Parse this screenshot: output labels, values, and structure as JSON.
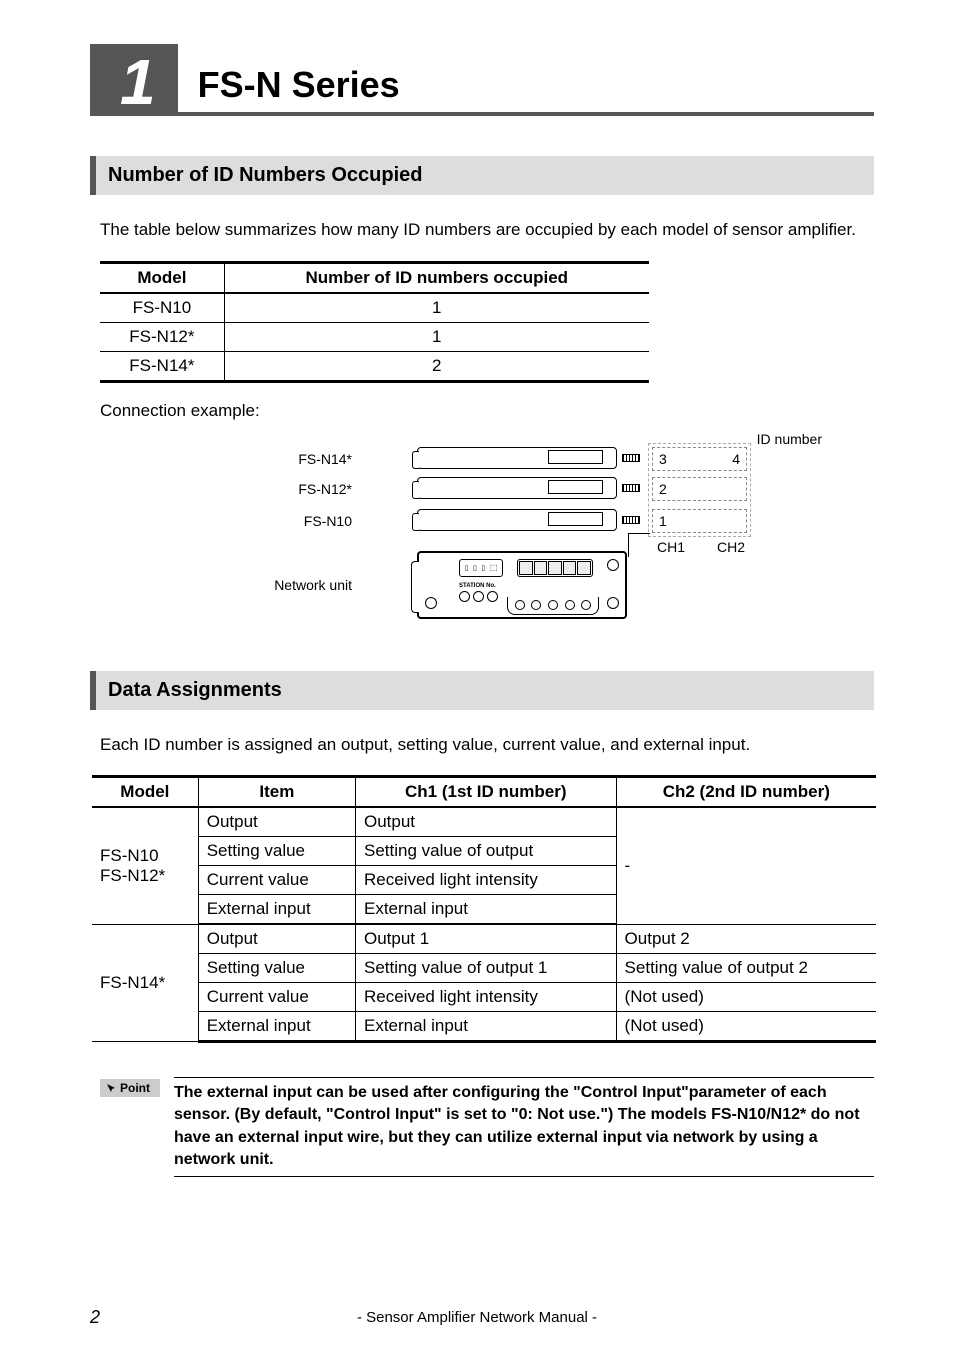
{
  "chapter": {
    "number": "1",
    "title": "FS-N Series"
  },
  "section1": {
    "heading": "Number of ID Numbers Occupied",
    "intro": "The table below summarizes how many ID numbers are occupied by each model of sensor amplifier.",
    "table_headers": [
      "Model",
      "Number of ID numbers occupied"
    ],
    "rows": [
      {
        "model": "FS-N10",
        "count": "1"
      },
      {
        "model": "FS-N12*",
        "count": "1"
      },
      {
        "model": "FS-N14*",
        "count": "2"
      }
    ],
    "conn_label": "Connection example:"
  },
  "diagram": {
    "id_number_title": "ID number",
    "labels": {
      "fsn14": "FS-N14*",
      "fsn12": "FS-N12*",
      "fsn10": "FS-N10",
      "network_unit": "Network unit",
      "station_no": "STATION No."
    },
    "ids": {
      "r1c1": "3",
      "r1c2": "4",
      "r2c1": "2",
      "r3c1": "1"
    },
    "channels": {
      "ch1": "CH1",
      "ch2": "CH2"
    }
  },
  "section2": {
    "heading": "Data Assignments",
    "intro": "Each ID number is assigned an output, setting value, current value, and external input.",
    "headers": [
      "Model",
      "Item",
      "Ch1 (1st ID number)",
      "Ch2 (2nd ID number)"
    ],
    "group1": {
      "model_line1": "FS-N10",
      "model_line2": "FS-N12*",
      "rows": [
        {
          "item": "Output",
          "ch1": "Output"
        },
        {
          "item": "Setting value",
          "ch1": "Setting value of output"
        },
        {
          "item": "Current value",
          "ch1": "Received light intensity"
        },
        {
          "item": "External input",
          "ch1": "External input"
        }
      ],
      "ch2_merged": "-"
    },
    "group2": {
      "model": "FS-N14*",
      "rows": [
        {
          "item": "Output",
          "ch1": "Output 1",
          "ch2": "Output 2"
        },
        {
          "item": "Setting value",
          "ch1": "Setting value of output 1",
          "ch2": "Setting value of output 2"
        },
        {
          "item": "Current value",
          "ch1": "Received light intensity",
          "ch2": "(Not used)"
        },
        {
          "item": "External input",
          "ch1": "External input",
          "ch2": "(Not used)"
        }
      ]
    }
  },
  "point": {
    "badge": "Point",
    "text": "The external input can be used after configuring the \"Control Input\"parameter of each sensor. (By default, \"Control Input\" is set to \"0: Not use.\") The models FS-N10/N12* do not have an external input wire, but they can utilize external input via network by using a network unit."
  },
  "footer": {
    "text": "- Sensor Amplifier Network Manual -",
    "page": "2"
  }
}
